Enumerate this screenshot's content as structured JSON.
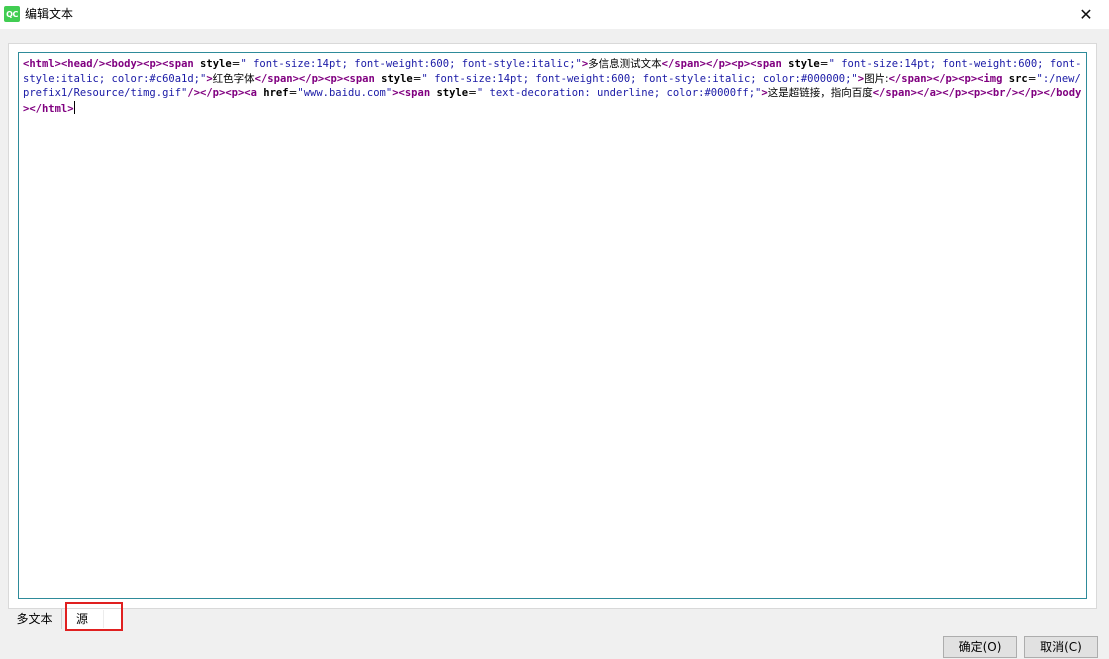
{
  "window": {
    "title": "编辑文本",
    "icon_label": "QC",
    "close_glyph": "✕"
  },
  "editor": {
    "segments": [
      {
        "t": "tag",
        "v": "<html>"
      },
      {
        "t": "tag",
        "v": "<head/>"
      },
      {
        "t": "tag",
        "v": "<body>"
      },
      {
        "t": "tag",
        "v": "<p>"
      },
      {
        "t": "tag",
        "v": "<span "
      },
      {
        "t": "attr",
        "v": "style"
      },
      {
        "t": "txt",
        "v": "="
      },
      {
        "t": "str",
        "v": "\" font-size:14pt; font-weight:600; font-style:italic;\""
      },
      {
        "t": "tag",
        "v": ">"
      },
      {
        "t": "txt",
        "v": "多信息测试文本"
      },
      {
        "t": "tag",
        "v": "</span>"
      },
      {
        "t": "tag",
        "v": "</p>"
      },
      {
        "t": "tag",
        "v": "<p>"
      },
      {
        "t": "tag",
        "v": "<span "
      },
      {
        "t": "attr",
        "v": "style"
      },
      {
        "t": "txt",
        "v": "="
      },
      {
        "t": "str",
        "v": "\" font-size:14pt; font-weight:600; font-style:italic; color:#c60a1d;\""
      },
      {
        "t": "tag",
        "v": ">"
      },
      {
        "t": "txt",
        "v": "红色字体"
      },
      {
        "t": "tag",
        "v": "</span>"
      },
      {
        "t": "tag",
        "v": "</p>"
      },
      {
        "t": "tag",
        "v": "<p>"
      },
      {
        "t": "tag",
        "v": "<span "
      },
      {
        "t": "attr",
        "v": "style"
      },
      {
        "t": "txt",
        "v": "="
      },
      {
        "t": "str",
        "v": "\" font-size:14pt; font-weight:600; font-style:italic; color:#000000;\""
      },
      {
        "t": "tag",
        "v": ">"
      },
      {
        "t": "txt",
        "v": "图片:"
      },
      {
        "t": "tag",
        "v": "</span>"
      },
      {
        "t": "tag",
        "v": "</p>"
      },
      {
        "t": "tag",
        "v": "<p>"
      },
      {
        "t": "tag",
        "v": "<img "
      },
      {
        "t": "attr",
        "v": "src"
      },
      {
        "t": "txt",
        "v": "="
      },
      {
        "t": "str",
        "v": "\":/new/prefix1/Resource/timg.gif\""
      },
      {
        "t": "tag",
        "v": "/>"
      },
      {
        "t": "tag",
        "v": "</p>"
      },
      {
        "t": "tag",
        "v": "<p>"
      },
      {
        "t": "tag",
        "v": "<a "
      },
      {
        "t": "attr",
        "v": "href"
      },
      {
        "t": "txt",
        "v": "="
      },
      {
        "t": "str",
        "v": "\"www.baidu.com\""
      },
      {
        "t": "tag",
        "v": ">"
      },
      {
        "t": "tag",
        "v": "<span "
      },
      {
        "t": "attr",
        "v": "style"
      },
      {
        "t": "txt",
        "v": "="
      },
      {
        "t": "str",
        "v": "\" text-decoration: underline; color:#0000ff;\""
      },
      {
        "t": "tag",
        "v": ">"
      },
      {
        "t": "txt",
        "v": "这是超链接，指向百度"
      },
      {
        "t": "tag",
        "v": "</span>"
      },
      {
        "t": "tag",
        "v": "</a>"
      },
      {
        "t": "tag",
        "v": "</p>"
      },
      {
        "t": "tag",
        "v": "<p>"
      },
      {
        "t": "tag",
        "v": "<br/>"
      },
      {
        "t": "tag",
        "v": "</p>"
      },
      {
        "t": "tag",
        "v": "</body>"
      },
      {
        "t": "tag",
        "v": "</html>"
      }
    ]
  },
  "tabs": [
    {
      "label": "多文本",
      "active": false
    },
    {
      "label": "源",
      "active": true
    }
  ],
  "buttons": {
    "ok_label": "确定(O)",
    "cancel_label": "取消(C)"
  },
  "colors": {
    "tag": "#800080",
    "string": "#1a1aa6",
    "editor_border": "#2e8b9a",
    "highlight": "#e02020",
    "qt_icon": "#41cd52"
  }
}
